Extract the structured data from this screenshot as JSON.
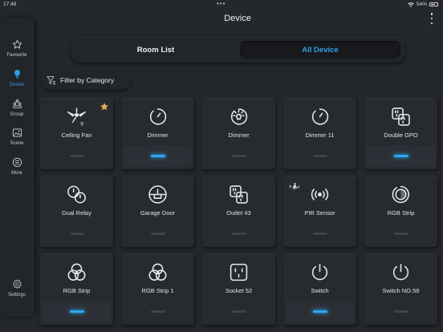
{
  "status_bar": {
    "time": "17:48",
    "battery": "54%"
  },
  "sidebar": {
    "items": [
      {
        "label": "Favourite",
        "icon": "star-icon",
        "active": false
      },
      {
        "label": "Device",
        "icon": "bulb-icon",
        "active": true
      },
      {
        "label": "Group",
        "icon": "group-icon",
        "active": false
      },
      {
        "label": "Scene",
        "icon": "scene-icon",
        "active": false
      },
      {
        "label": "More",
        "icon": "more-icon",
        "active": false
      },
      {
        "label": "Settings",
        "icon": "gear-icon",
        "active": false
      }
    ]
  },
  "header": {
    "title": "Device"
  },
  "tabs": {
    "room_list": "Room List",
    "all_device": "All Device",
    "selected": "All Device"
  },
  "filter": {
    "label": "Filter by Category"
  },
  "colors": {
    "accent": "#2ea1e6",
    "favourite_star": "#e8a555"
  },
  "devices": [
    {
      "name": "Ceiling Fan",
      "icon": "ceiling-fan-icon",
      "badge": "9",
      "favourite": true,
      "on": false
    },
    {
      "name": "Dimmer",
      "icon": "dimmer-icon",
      "on": true
    },
    {
      "name": "Dimmer",
      "icon": "dimmer-bulb-icon",
      "on": false
    },
    {
      "name": "Dimmer 11",
      "icon": "dimmer-icon",
      "on": false
    },
    {
      "name": "Double GPO",
      "icon": "double-gpo-icon",
      "on": true
    },
    {
      "name": "Dual Relay",
      "icon": "dual-relay-icon",
      "on": false
    },
    {
      "name": "Garage Door",
      "icon": "garage-door-icon",
      "on": false
    },
    {
      "name": "Outlet 43",
      "icon": "double-gpo-icon",
      "on": false
    },
    {
      "name": "PIR Sensor",
      "icon": "pir-sensor-icon",
      "motion": true,
      "on": false
    },
    {
      "name": "RGB Strip",
      "icon": "rgb-strip-icon",
      "on": false
    },
    {
      "name": "RGB Strip",
      "icon": "rgb-circles-icon",
      "on": true
    },
    {
      "name": "RGB Strip 1",
      "icon": "rgb-circles-icon",
      "on": false
    },
    {
      "name": "Socket 52",
      "icon": "socket-icon",
      "on": false
    },
    {
      "name": "Switch",
      "icon": "power-icon",
      "on": true
    },
    {
      "name": "Switch NO.58",
      "icon": "power-icon",
      "on": false
    }
  ]
}
